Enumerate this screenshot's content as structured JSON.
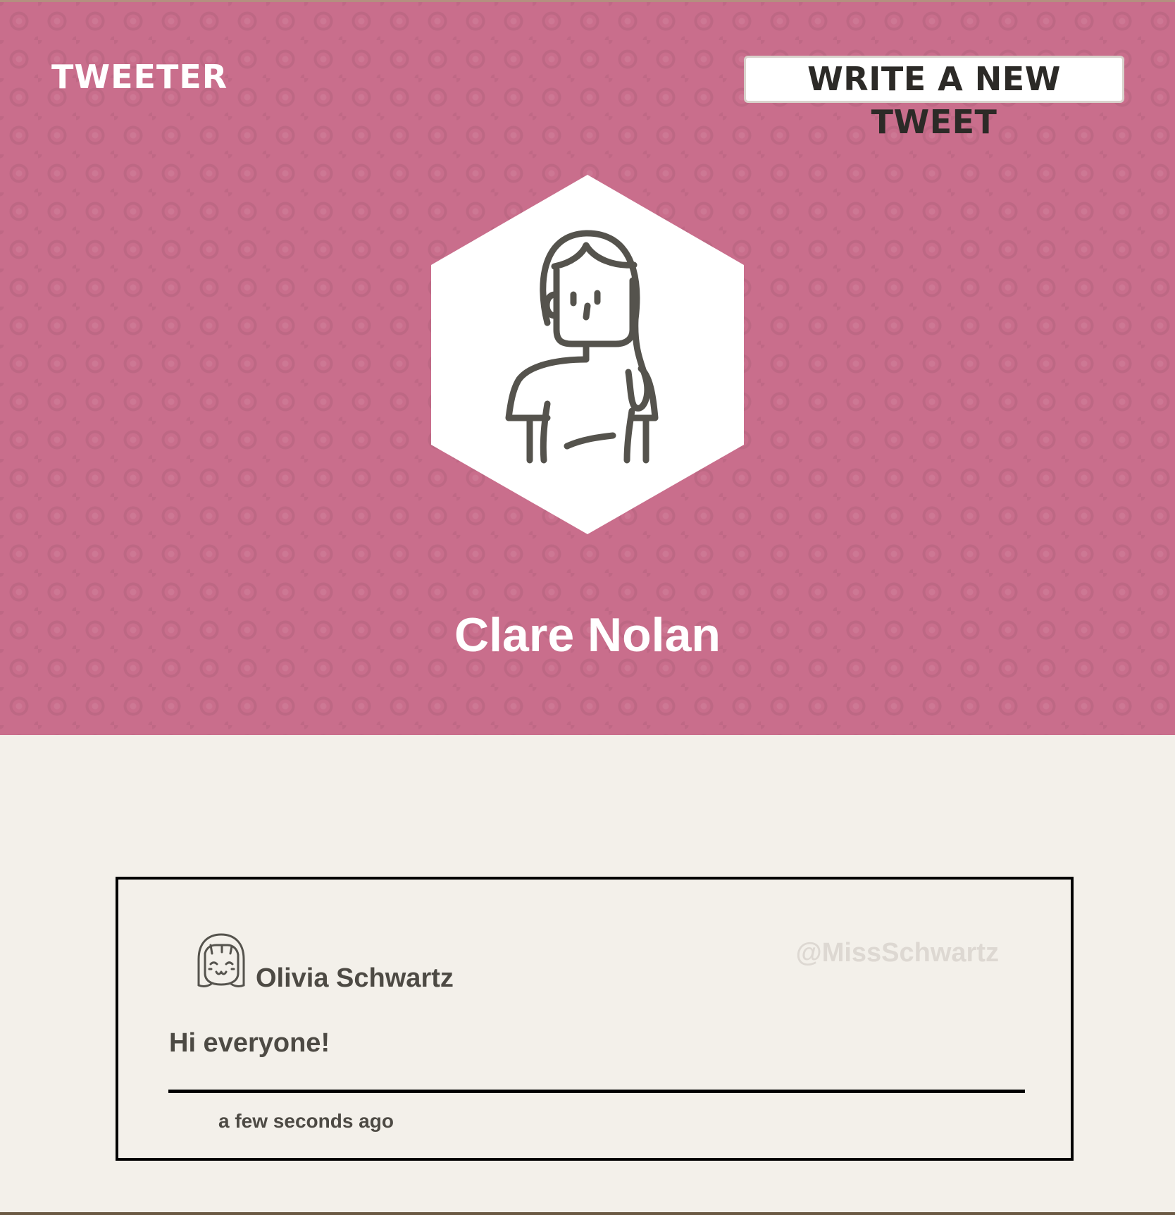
{
  "header": {
    "brand": "TWEETER",
    "write_button_label": "WRITE A NEW TWEET",
    "avatar_icon": "woman-avatar-icon",
    "profile_name": "Clare Nolan"
  },
  "tweet": {
    "avatar_icon": "smiling-girl-avatar-icon",
    "author_name": "Olivia Schwartz",
    "handle": "@MissSchwartz",
    "text": "Hi everyone!",
    "timestamp": "a few seconds ago"
  },
  "colors": {
    "header_background": "#c96e8c",
    "page_background": "#f3f0ea",
    "text_dark": "#4d4a44",
    "handle_text": "#ddd8d2"
  }
}
